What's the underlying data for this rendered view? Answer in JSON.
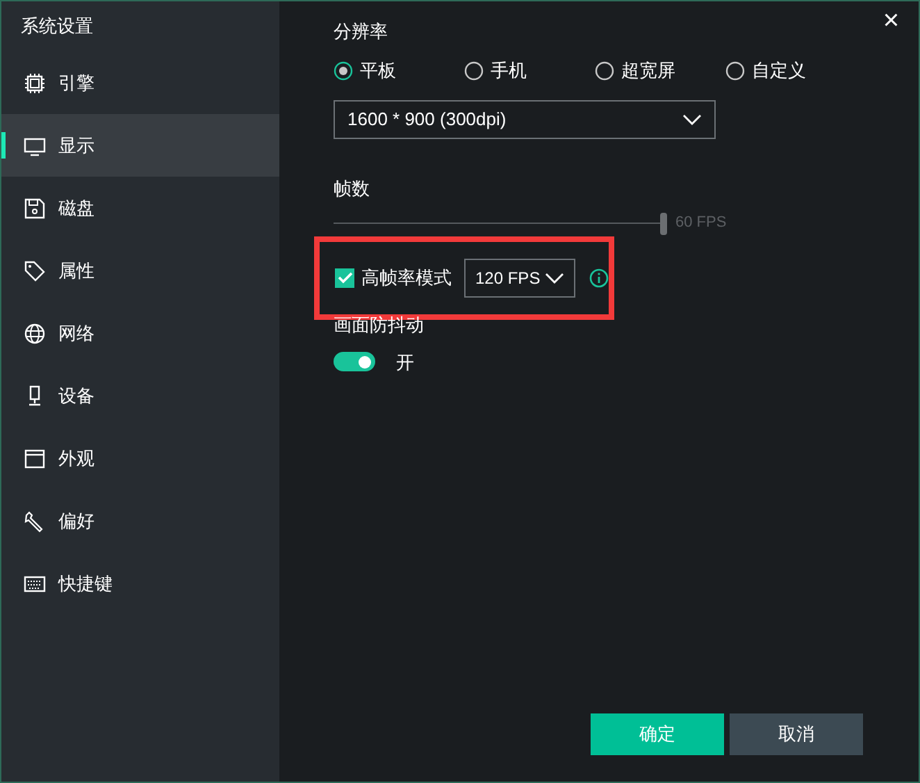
{
  "window": {
    "title": "系统设置",
    "close": "×"
  },
  "sidebar": {
    "items": [
      {
        "label": "引擎",
        "selected": false
      },
      {
        "label": "显示",
        "selected": true
      },
      {
        "label": "磁盘",
        "selected": false
      },
      {
        "label": "属性",
        "selected": false
      },
      {
        "label": "网络",
        "selected": false
      },
      {
        "label": "设备",
        "selected": false
      },
      {
        "label": "外观",
        "selected": false
      },
      {
        "label": "偏好",
        "selected": false
      },
      {
        "label": "快捷键",
        "selected": false
      }
    ]
  },
  "resolution": {
    "title": "分辨率",
    "options": [
      {
        "label": "平板",
        "selected": true
      },
      {
        "label": "手机",
        "selected": false
      },
      {
        "label": "超宽屏",
        "selected": false
      },
      {
        "label": "自定义",
        "selected": false
      }
    ],
    "dropdown": "1600 * 900 (300dpi)"
  },
  "fps": {
    "title": "帧数",
    "slider": {
      "level": 1,
      "disabled": true,
      "reading": "60 FPS"
    },
    "high_fps": {
      "label": "高帧率模式",
      "checked": true,
      "dropdown": "120 FPS",
      "highlighted": true
    }
  },
  "stabilization": {
    "title": "画面防抖动",
    "on": true,
    "label": "开"
  },
  "buttons": [
    {
      "label": "确定",
      "kind": "primary"
    },
    {
      "label": "取消",
      "kind": "secondary"
    }
  ]
}
